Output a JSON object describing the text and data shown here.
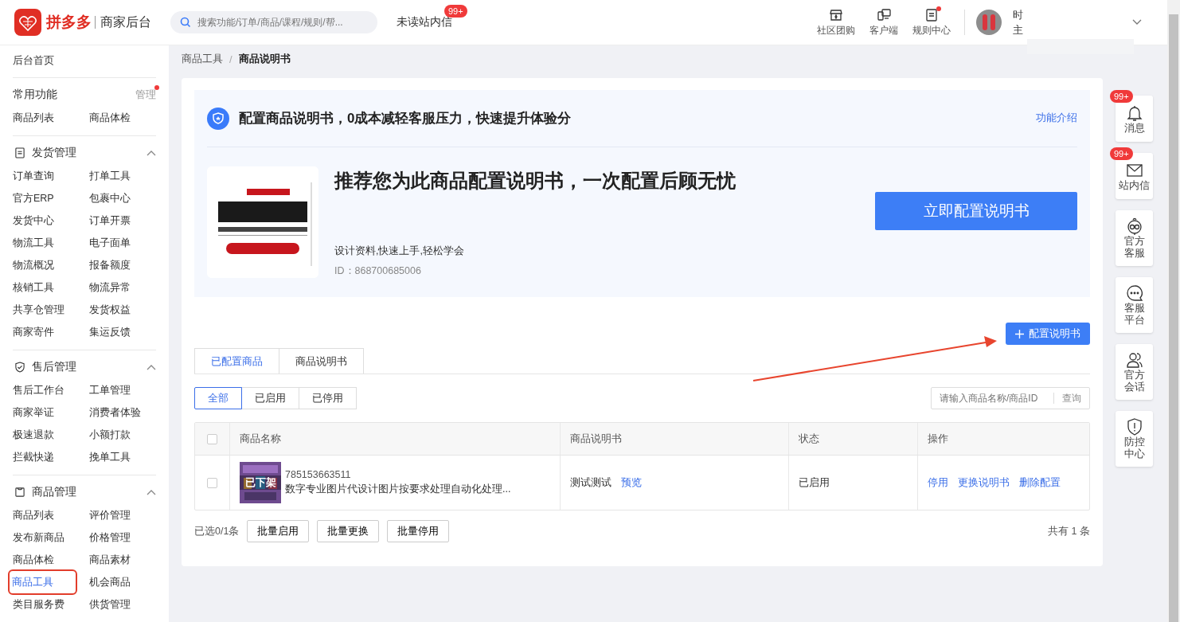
{
  "header": {
    "brand": "拼多多",
    "subtitle": "商家后台",
    "search": {
      "placeholder": "搜索功能/订单/商品/课程/规则/帮..."
    },
    "unread": {
      "label": "未读站内信",
      "badge": "99+"
    },
    "nav_items": [
      {
        "label": "社区团购",
        "dot": false
      },
      {
        "label": "客户端",
        "dot": false
      },
      {
        "label": "规则中心",
        "dot": true
      }
    ],
    "user": {
      "name": "时",
      "role": "主"
    }
  },
  "sidebar": {
    "home": "后台首页",
    "favorites": {
      "title": "常用功能",
      "manage": "管理",
      "manage_dot": true,
      "items": [
        {
          "label": "商品列表",
          "selected": false
        },
        {
          "label": "商品体检",
          "selected": false
        }
      ]
    },
    "groups": [
      {
        "title": "发货管理",
        "expanded": true,
        "items": [
          {
            "label": "订单查询",
            "selected": false
          },
          {
            "label": "打单工具",
            "selected": false
          },
          {
            "label": "官方ERP",
            "selected": false
          },
          {
            "label": "包裹中心",
            "selected": false
          },
          {
            "label": "发货中心",
            "selected": false
          },
          {
            "label": "订单开票",
            "selected": false
          },
          {
            "label": "物流工具",
            "selected": false
          },
          {
            "label": "电子面单",
            "selected": false
          },
          {
            "label": "物流概况",
            "selected": false
          },
          {
            "label": "报备额度",
            "selected": false
          },
          {
            "label": "核销工具",
            "selected": false
          },
          {
            "label": "物流异常",
            "selected": false
          },
          {
            "label": "共享仓管理",
            "selected": false
          },
          {
            "label": "发货权益",
            "selected": false
          },
          {
            "label": "商家寄件",
            "selected": false
          },
          {
            "label": "集运反馈",
            "selected": false
          }
        ]
      },
      {
        "title": "售后管理",
        "expanded": true,
        "items": [
          {
            "label": "售后工作台",
            "selected": false
          },
          {
            "label": "工单管理",
            "selected": false
          },
          {
            "label": "商家举证",
            "selected": false
          },
          {
            "label": "消费者体验",
            "selected": false
          },
          {
            "label": "极速退款",
            "selected": false
          },
          {
            "label": "小额打款",
            "selected": false
          },
          {
            "label": "拦截快递",
            "selected": false
          },
          {
            "label": "挽单工具",
            "selected": false
          }
        ]
      },
      {
        "title": "商品管理",
        "expanded": true,
        "items": [
          {
            "label": "商品列表",
            "selected": false
          },
          {
            "label": "评价管理",
            "selected": false
          },
          {
            "label": "发布新商品",
            "selected": false
          },
          {
            "label": "价格管理",
            "selected": false
          },
          {
            "label": "商品体检",
            "selected": false
          },
          {
            "label": "商品素材",
            "selected": false
          },
          {
            "label": "商品工具",
            "selected": true,
            "highlighted": true
          },
          {
            "label": "机会商品",
            "selected": false
          },
          {
            "label": "类目服务费",
            "selected": false
          },
          {
            "label": "供货管理",
            "selected": false
          }
        ]
      }
    ]
  },
  "breadcrumb": {
    "items": [
      "商品工具",
      "商品说明书"
    ],
    "separator": "/"
  },
  "banner": {
    "title": "配置商品说明书，0成本减轻客服压力，快速提升体验分",
    "link": "功能介绍",
    "recommend": {
      "title": "推荐您为此商品配置说明书，一次配置后顾无忧",
      "description": "设计资料,快速上手,轻松学会",
      "id": "ID：868700685006"
    },
    "button": "立即配置说明书"
  },
  "add_button": "配置说明书",
  "tabs": [
    {
      "label": "已配置商品",
      "selected": true
    },
    {
      "label": "商品说明书",
      "selected": false
    }
  ],
  "filters": [
    {
      "label": "全部",
      "selected": true
    },
    {
      "label": "已启用",
      "selected": false
    },
    {
      "label": "已停用",
      "selected": false
    }
  ],
  "search": {
    "placeholder": "请输入商品名称/商品ID",
    "button": "查询"
  },
  "table": {
    "select_all_checked": false,
    "columns": [
      "商品名称",
      "商品说明书",
      "状态",
      "操作"
    ],
    "rows": [
      {
        "checked": false,
        "thumb_status": "已下架",
        "product_id": "785153663511",
        "product_name": "数字专业图片代设计图片按要求处理自动化处理...",
        "manual": "测试测试",
        "manual_link": "预览",
        "status": "已启用",
        "actions": [
          "停用",
          "更换说明书",
          "删除配置"
        ]
      }
    ]
  },
  "footer": {
    "selected_count": "已选0/1条",
    "buttons": [
      "批量启用",
      "批量更换",
      "批量停用"
    ],
    "total": "共有 1 条"
  },
  "float_bar": [
    {
      "label": "消息",
      "badge": "99+"
    },
    {
      "label": "站内信",
      "badge": "99+"
    },
    {
      "label": "官方客服"
    },
    {
      "label": "客服平台"
    },
    {
      "label": "官方会话"
    },
    {
      "label": "防控中心"
    }
  ],
  "annotations": [
    {
      "kind": "arrow"
    }
  ]
}
